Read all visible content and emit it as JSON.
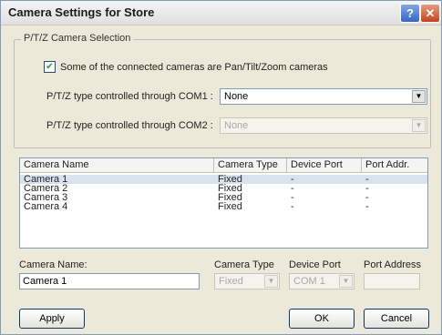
{
  "window": {
    "title": "Camera Settings for Store",
    "help_glyph": "?",
    "close_glyph": "✕"
  },
  "ptz": {
    "group_label": "P/T/Z Camera Selection",
    "checkbox_label": "Some of the connected cameras are Pan/Tilt/Zoom cameras",
    "checkbox_checked": true,
    "com1_label": "P/T/Z type controlled through COM1 :",
    "com1_value": "None",
    "com2_label": "P/T/Z type controlled through COM2 :",
    "com2_value": "None"
  },
  "camera_list": {
    "columns": [
      "Camera Name",
      "Camera Type",
      "Device Port",
      "Port Addr."
    ],
    "rows": [
      [
        "Camera 1",
        "Fixed",
        "-",
        "-"
      ],
      [
        "Camera 2",
        "Fixed",
        "-",
        "-"
      ],
      [
        "Camera 3",
        "Fixed",
        "-",
        "-"
      ],
      [
        "Camera 4",
        "Fixed",
        "-",
        "-"
      ]
    ],
    "selected_row": 0
  },
  "details": {
    "name_label": "Camera Name:",
    "name_value": "Camera 1",
    "type_label": "Camera Type",
    "type_value": "Fixed",
    "port_label": "Device Port",
    "port_value": "COM 1",
    "address_label": "Port Address",
    "address_value": ""
  },
  "buttons": {
    "apply": "Apply",
    "ok": "OK",
    "cancel": "Cancel"
  },
  "icons": {
    "dropdown": "▼"
  },
  "colors": {
    "window_bg": "#ece9d8",
    "selection": "#d9e3ef",
    "border": "#7f9db9"
  }
}
